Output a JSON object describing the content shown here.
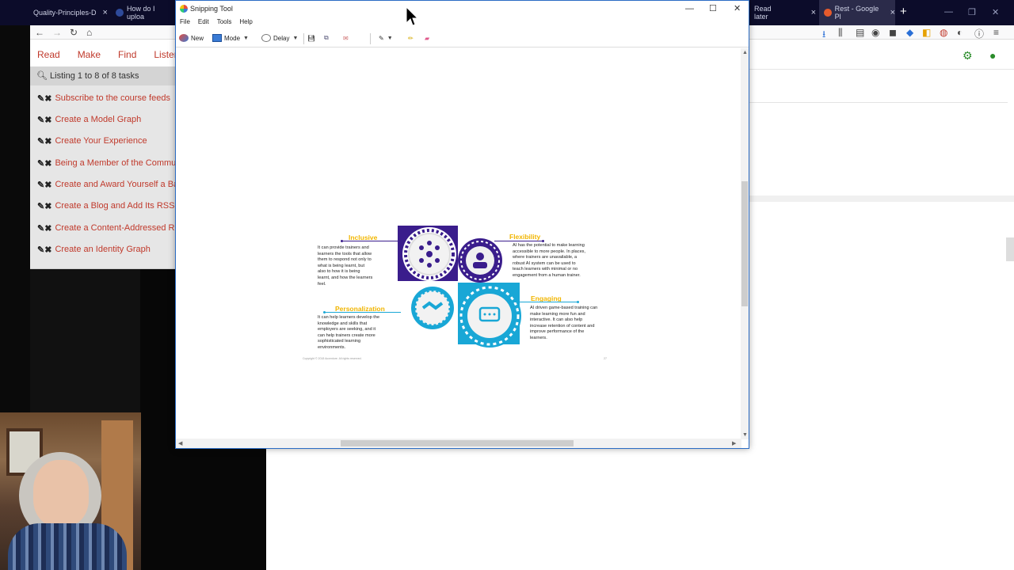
{
  "browser": {
    "tabs": [
      {
        "label": "Quality-Principles-D",
        "color": "#3a6fd0"
      },
      {
        "label": "How do I uploa",
        "color": "#2e4a9a"
      },
      {
        "label": "Read later",
        "color": "#4a5cc0"
      },
      {
        "label": "Rest - Google Pl",
        "color": "#e65b2c"
      }
    ],
    "new_tab": "+"
  },
  "app_menu": [
    "Read",
    "Make",
    "Find",
    "Listen"
  ],
  "listing": "Listing 1 to 8 of 8 tasks",
  "tasks": [
    "Subscribe to the course feeds",
    "Create a Model Graph",
    "Create Your Experience",
    "Being a Member of the Community",
    "Create and Award Yourself a Badge",
    "Create a Blog and Add Its RSS",
    "Create a Content-Addressed Resource",
    "Create an Identity Graph"
  ],
  "snip": {
    "title": "Snipping Tool",
    "menu": [
      "File",
      "Edit",
      "Tools",
      "Help"
    ],
    "toolbar": {
      "new": "New",
      "mode": "Mode",
      "delay": "Delay"
    }
  },
  "slide": {
    "inclusive": {
      "title": "Inclusive",
      "lines": [
        "It can provide trainers and",
        "learners the tools that allow",
        "them to respond not only to",
        "what is being learnt, but",
        "also to how it is being",
        "learnt, and how the learners",
        "feel."
      ]
    },
    "flexibility": {
      "title": "Flexibility",
      "lines": [
        "AI has the potential to make learning",
        "accessible to more people. In places,",
        "where trainers are unavailable, a",
        "robust AI system can be used to",
        "teach learners with minimal or no",
        "engagement from a human trainer."
      ]
    },
    "personalization": {
      "title": "Personalization",
      "lines": [
        "It can help learners develop the",
        "knowledge and skills that",
        "employers are seeking, and it",
        "can help trainers create more",
        "sophisticated learning",
        "environments."
      ]
    },
    "engaging": {
      "title": "Engaging",
      "lines": [
        "AI driven game-based training can",
        "make learning more fun and",
        "interactive. It can also help",
        "increase retention of content and",
        "improve performance of the",
        "learners."
      ]
    },
    "copyright": "Copyright © 2018 Accenture. All rights reserved.",
    "page": "27",
    "colors": {
      "purple": "#3a1d8c",
      "cyan": "#19a7d6",
      "gold": "#f1b500"
    }
  }
}
